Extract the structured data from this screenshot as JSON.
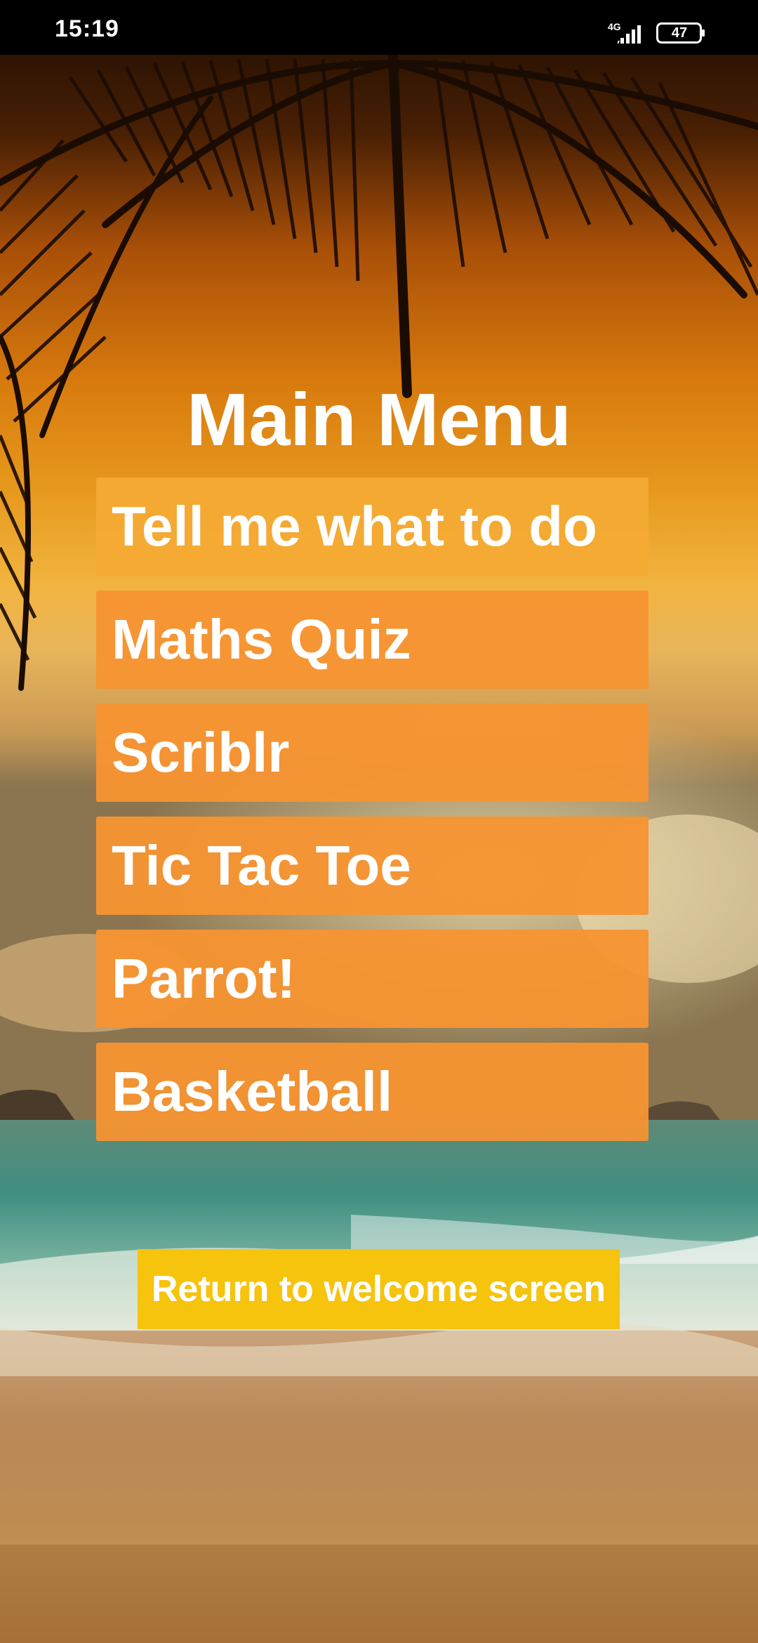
{
  "status_bar": {
    "time": "15:19",
    "network": "4G",
    "battery": "47"
  },
  "title": "Main Menu",
  "menu": {
    "items": [
      {
        "label": "Tell me what to do"
      },
      {
        "label": "Maths Quiz"
      },
      {
        "label": "Scriblr"
      },
      {
        "label": "Tic Tac Toe"
      },
      {
        "label": "Parrot!"
      },
      {
        "label": "Basketball"
      }
    ]
  },
  "return_button": {
    "label": "Return to welcome screen"
  },
  "colors": {
    "menu_button": "#f79432",
    "menu_button_first": "#f4aa34",
    "return_button": "#f6c30d",
    "text": "#ffffff"
  },
  "background": {
    "scene": "tropical-beach-sunset"
  }
}
